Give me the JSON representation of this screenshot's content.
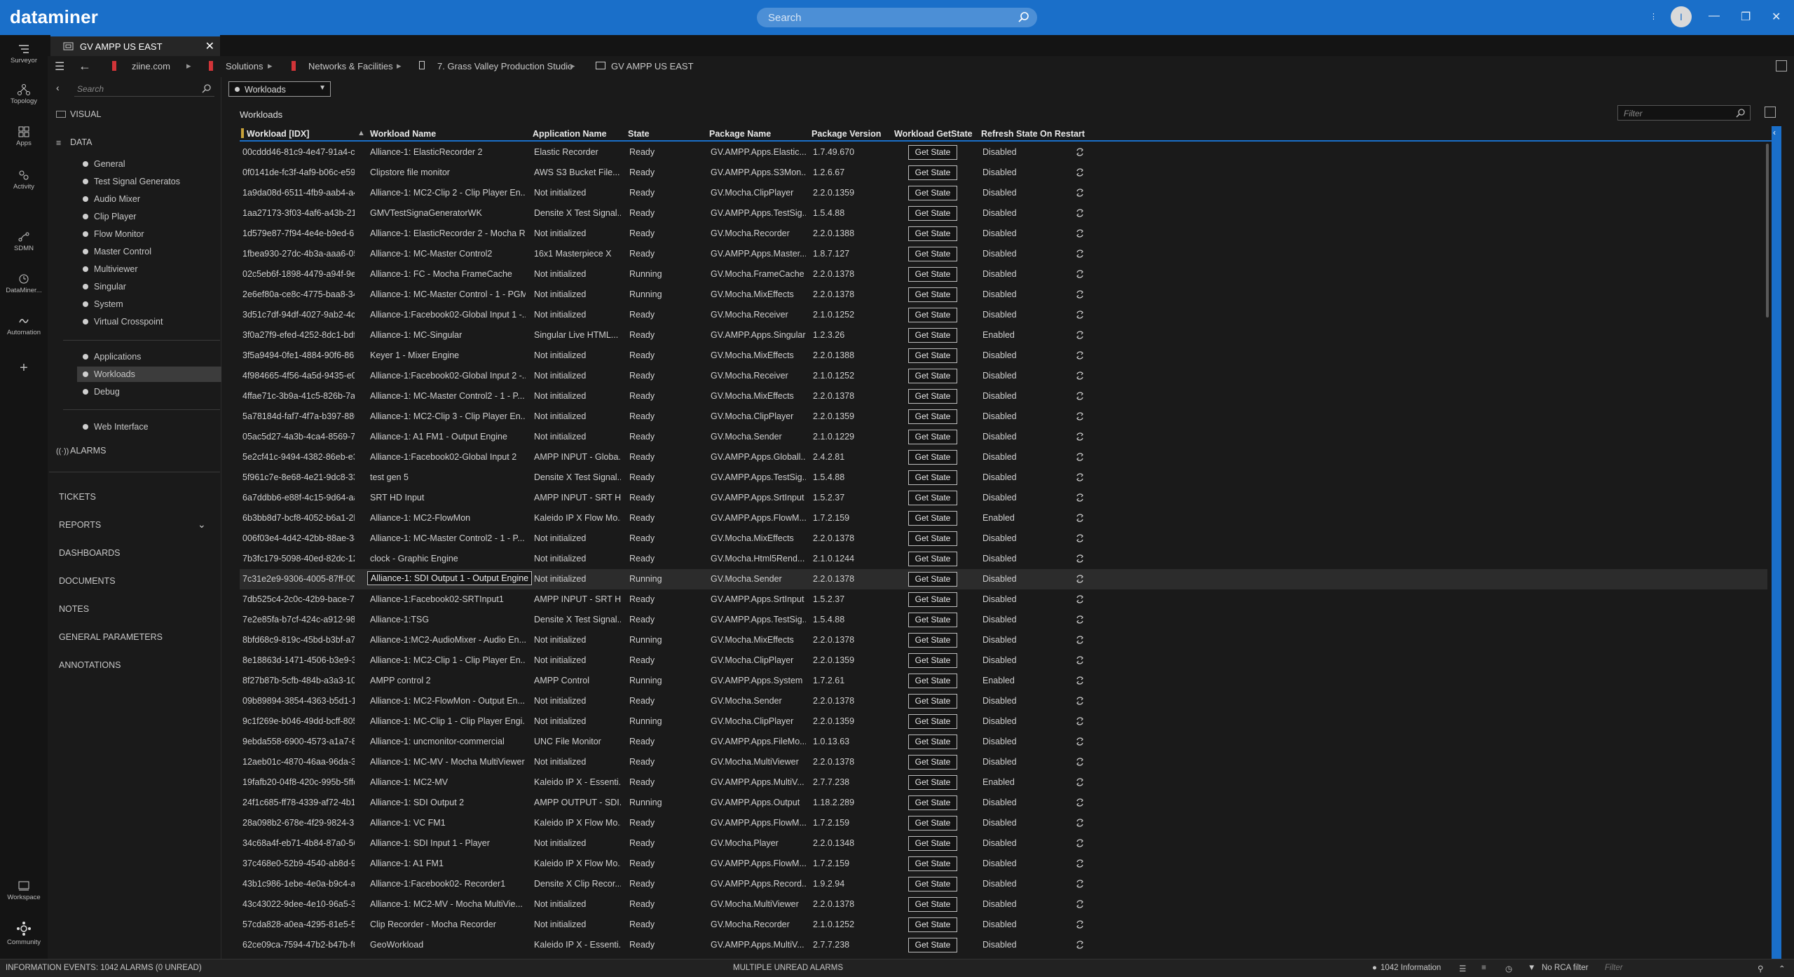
{
  "app": {
    "brand": "dataminer",
    "search_placeholder": "Search",
    "user_initial": "I"
  },
  "rail": [
    {
      "label": "Surveyor",
      "icon": "surveyor-icon"
    },
    {
      "label": "Topology",
      "icon": "topology-icon"
    },
    {
      "label": "Apps",
      "icon": "apps-icon"
    },
    {
      "label": "Activity",
      "icon": "activity-icon"
    },
    {
      "label": "SDMN",
      "icon": "sdmn-icon"
    },
    {
      "label": "DataMiner...",
      "icon": "dataminer-icon"
    },
    {
      "label": "Automation",
      "icon": "automation-icon"
    },
    {
      "label": "",
      "icon": "plus-icon"
    },
    {
      "label": "Workspace",
      "icon": "workspace-icon"
    },
    {
      "label": "Community",
      "icon": "community-icon"
    }
  ],
  "tab": {
    "label": "GV AMPP US EAST"
  },
  "breadcrumb": [
    "ziine.com",
    "Solutions",
    "Networks & Facilities",
    "7. Grass Valley Production Studio",
    "GV AMPP US EAST"
  ],
  "left_panel": {
    "search_placeholder": "Search",
    "visual": "VISUAL",
    "data": "DATA",
    "data_items": [
      "General",
      "Test Signal Generatos",
      "Audio Mixer",
      "Clip Player",
      "Flow Monitor",
      "Master Control",
      "Multiviewer",
      "Singular",
      "System",
      "Virtual Crosspoint"
    ],
    "items2": [
      "Applications",
      "Workloads",
      "Debug"
    ],
    "items3": [
      "Web Interface"
    ],
    "alarms": "ALARMS",
    "menu": [
      "TICKETS",
      "REPORTS",
      "DASHBOARDS",
      "DOCUMENTS",
      "NOTES",
      "GENERAL PARAMETERS",
      "ANNOTATIONS"
    ]
  },
  "main": {
    "dropdown_value": "Workloads",
    "table_title": "Workloads",
    "filter_placeholder": "Filter",
    "columns": [
      "Workload [IDX]",
      "Workload Name",
      "Application Name",
      "State",
      "Package Name",
      "Package Version",
      "Workload GetState",
      "Refresh State On Restart"
    ],
    "button_label": "Get State",
    "rows": [
      [
        "00cddd46-81c9-4e47-91a4-c2...",
        "Alliance-1: ElasticRecorder 2",
        "Elastic Recorder",
        "Ready",
        "GV.AMPP.Apps.Elastic...",
        "1.7.49.670",
        "Disabled"
      ],
      [
        "0f0141de-fc3f-4af9-b06c-e596...",
        "Clipstore file monitor",
        "AWS S3 Bucket File...",
        "Ready",
        "GV.AMPP.Apps.S3Mon...",
        "1.2.6.67",
        "Disabled"
      ],
      [
        "1a9da08d-6511-4fb9-aab4-a4...",
        "Alliance-1: MC2-Clip 2 - Clip Player En...",
        "Not initialized",
        "Ready",
        "GV.Mocha.ClipPlayer",
        "2.2.0.1359",
        "Disabled"
      ],
      [
        "1aa27173-3f03-4af6-a43b-215...",
        "GMVTestSignaGeneratorWK",
        "Densite X Test Signal...",
        "Ready",
        "GV.AMPP.Apps.TestSig...",
        "1.5.4.88",
        "Disabled"
      ],
      [
        "1d579e87-7f94-4e4e-b9ed-61...",
        "Alliance-1: ElasticRecorder 2 - Mocha R...",
        "Not initialized",
        "Ready",
        "GV.Mocha.Recorder",
        "2.2.0.1388",
        "Disabled"
      ],
      [
        "1fbea930-27dc-4b3a-aaa6-05...",
        "Alliance-1: MC-Master Control2",
        "16x1 Masterpiece X",
        "Ready",
        "GV.AMPP.Apps.Master...",
        "1.8.7.127",
        "Disabled"
      ],
      [
        "02c5eb6f-1898-4479-a94f-9e3...",
        "Alliance-1: FC - Mocha FrameCache",
        "Not initialized",
        "Running",
        "GV.Mocha.FrameCache",
        "2.2.0.1378",
        "Disabled"
      ],
      [
        "2e6ef80a-ce8c-4775-baa8-34e...",
        "Alliance-1: MC-Master Control - 1 - PGM",
        "Not initialized",
        "Running",
        "GV.Mocha.MixEffects",
        "2.2.0.1378",
        "Disabled"
      ],
      [
        "3d51c7df-94df-4027-9ab2-4cc...",
        "Alliance-1:Facebook02-Global Input 1 -...",
        "Not initialized",
        "Ready",
        "GV.Mocha.Receiver",
        "2.1.0.1252",
        "Disabled"
      ],
      [
        "3f0a27f9-efed-4252-8dc1-bdf...",
        "Alliance-1: MC-Singular",
        "Singular Live HTML...",
        "Ready",
        "GV.AMPP.Apps.Singular",
        "1.2.3.26",
        "Enabled"
      ],
      [
        "3f5a9494-0fe1-4884-90f6-86b...",
        "Keyer 1 - Mixer Engine",
        "Not initialized",
        "Ready",
        "GV.Mocha.MixEffects",
        "2.2.0.1388",
        "Disabled"
      ],
      [
        "4f984665-4f56-4a5d-9435-e00...",
        "Alliance-1:Facebook02-Global Input 2 -...",
        "Not initialized",
        "Ready",
        "GV.Mocha.Receiver",
        "2.1.0.1252",
        "Disabled"
      ],
      [
        "4ffae71c-3b9a-41c5-826b-7a1...",
        "Alliance-1: MC-Master Control2 - 1 - P...",
        "Not initialized",
        "Ready",
        "GV.Mocha.MixEffects",
        "2.2.0.1378",
        "Disabled"
      ],
      [
        "5a78184d-faf7-4f7a-b397-880...",
        "Alliance-1: MC2-Clip 3 - Clip Player En...",
        "Not initialized",
        "Ready",
        "GV.Mocha.ClipPlayer",
        "2.2.0.1359",
        "Disabled"
      ],
      [
        "05ac5d27-4a3b-4ca4-8569-71...",
        "Alliance-1: A1 FM1 - Output Engine",
        "Not initialized",
        "Ready",
        "GV.Mocha.Sender",
        "2.1.0.1229",
        "Disabled"
      ],
      [
        "5e2cf41c-9494-4382-86eb-e33...",
        "Alliance-1:Facebook02-Global Input 2",
        "AMPP INPUT - Globa...",
        "Ready",
        "GV.AMPP.Apps.Globall...",
        "2.4.2.81",
        "Disabled"
      ],
      [
        "5f961c7e-8e68-4e21-9dc8-335...",
        "test gen 5",
        "Densite X Test Signal...",
        "Ready",
        "GV.AMPP.Apps.TestSig...",
        "1.5.4.88",
        "Disabled"
      ],
      [
        "6a7ddbb6-e88f-4c15-9d64-aa...",
        "SRT HD Input",
        "AMPP INPUT - SRT HD",
        "Ready",
        "GV.AMPP.Apps.SrtInput",
        "1.5.2.37",
        "Disabled"
      ],
      [
        "6b3bb8d7-bcf8-4052-b6a1-2b...",
        "Alliance-1: MC2-FlowMon",
        "Kaleido IP X Flow Mo...",
        "Ready",
        "GV.AMPP.Apps.FlowM...",
        "1.7.2.159",
        "Enabled"
      ],
      [
        "006f03e4-4d42-42bb-88ae-34...",
        "Alliance-1: MC-Master Control2 - 1 - P...",
        "Not initialized",
        "Ready",
        "GV.Mocha.MixEffects",
        "2.2.0.1378",
        "Disabled"
      ],
      [
        "7b3fc179-5098-40ed-82dc-12...",
        "clock - Graphic Engine",
        "Not initialized",
        "Ready",
        "GV.Mocha.Html5Rend...",
        "2.1.0.1244",
        "Disabled"
      ],
      [
        "7c31e2e9-9306-4005-87ff-00a...",
        "Alliance-1: SDI Output 1 - Output Engine",
        "Not initialized",
        "Running",
        "GV.Mocha.Sender",
        "2.2.0.1378",
        "Disabled"
      ],
      [
        "7db525c4-2c0c-42b9-bace-78...",
        "Alliance-1:Facebook02-SRTInput1",
        "AMPP INPUT - SRT HD",
        "Ready",
        "GV.AMPP.Apps.SrtInput",
        "1.5.2.37",
        "Disabled"
      ],
      [
        "7e2e85fa-b7cf-424c-a912-983...",
        "Alliance-1:TSG",
        "Densite X Test Signal...",
        "Ready",
        "GV.AMPP.Apps.TestSig...",
        "1.5.4.88",
        "Disabled"
      ],
      [
        "8bfd68c9-819c-45bd-b3bf-a7...",
        "Alliance-1:MC2-AudioMixer - Audio En...",
        "Not initialized",
        "Running",
        "GV.Mocha.MixEffects",
        "2.2.0.1378",
        "Disabled"
      ],
      [
        "8e18863d-1471-4506-b3e9-39...",
        "Alliance-1: MC2-Clip 1 - Clip Player En...",
        "Not initialized",
        "Ready",
        "GV.Mocha.ClipPlayer",
        "2.2.0.1359",
        "Disabled"
      ],
      [
        "8f27b87b-5cfb-484b-a3a3-10c...",
        "AMPP control 2",
        "AMPP Control",
        "Running",
        "GV.AMPP.Apps.System",
        "1.7.2.61",
        "Enabled"
      ],
      [
        "09b89894-3854-4363-b5d1-1a...",
        "Alliance-1: MC2-FlowMon - Output En...",
        "Not initialized",
        "Ready",
        "GV.Mocha.Sender",
        "2.2.0.1378",
        "Disabled"
      ],
      [
        "9c1f269e-b046-49dd-bcff-805...",
        "Alliance-1: MC-Clip 1 - Clip Player Engi...",
        "Not initialized",
        "Running",
        "GV.Mocha.ClipPlayer",
        "2.2.0.1359",
        "Disabled"
      ],
      [
        "9ebda558-6900-4573-a1a7-8e...",
        "Alliance-1: uncmonitor-commercial",
        "UNC File Monitor",
        "Ready",
        "GV.AMPP.Apps.FileMo...",
        "1.0.13.63",
        "Disabled"
      ],
      [
        "12aeb01c-4870-46aa-96da-3b...",
        "Alliance-1: MC-MV - Mocha MultiViewer",
        "Not initialized",
        "Ready",
        "GV.Mocha.MultiViewer",
        "2.2.0.1378",
        "Disabled"
      ],
      [
        "19fafb20-04f8-420c-995b-5ffd...",
        "Alliance-1: MC2-MV",
        "Kaleido IP X - Essenti...",
        "Ready",
        "GV.AMPP.Apps.MultiV...",
        "2.7.7.238",
        "Enabled"
      ],
      [
        "24f1c685-ff78-4339-af72-4b14...",
        "Alliance-1: SDI Output 2",
        "AMPP OUTPUT - SDI...",
        "Running",
        "GV.AMPP.Apps.Output",
        "1.18.2.289",
        "Disabled"
      ],
      [
        "28a098b2-678e-4f29-9824-310...",
        "Alliance-1: VC FM1",
        "Kaleido IP X Flow Mo...",
        "Ready",
        "GV.AMPP.Apps.FlowM...",
        "1.7.2.159",
        "Disabled"
      ],
      [
        "34c68a4f-eb71-4b84-87a0-507...",
        "Alliance-1: SDI Input 1 - Player",
        "Not initialized",
        "Ready",
        "GV.Mocha.Player",
        "2.2.0.1348",
        "Disabled"
      ],
      [
        "37c468e0-52b9-4540-ab8d-9e...",
        "Alliance-1: A1 FM1",
        "Kaleido IP X Flow Mo...",
        "Ready",
        "GV.AMPP.Apps.FlowM...",
        "1.7.2.159",
        "Disabled"
      ],
      [
        "43b1c986-1ebe-4e0a-b9c4-a7...",
        "Alliance-1:Facebook02- Recorder1",
        "Densite X Clip Recor...",
        "Ready",
        "GV.AMPP.Apps.Record...",
        "1.9.2.94",
        "Disabled"
      ],
      [
        "43c43022-9dee-4e10-96a5-31...",
        "Alliance-1: MC2-MV - Mocha MultiVie...",
        "Not initialized",
        "Ready",
        "GV.Mocha.MultiViewer",
        "2.2.0.1378",
        "Disabled"
      ],
      [
        "57cda828-a0ea-4295-81e5-59...",
        "Clip Recorder - Mocha Recorder",
        "Not initialized",
        "Ready",
        "GV.Mocha.Recorder",
        "2.1.0.1252",
        "Disabled"
      ],
      [
        "62ce09ca-7594-47b2-b47b-f6...",
        "GeoWorkload",
        "Kaleido IP X - Essenti...",
        "Ready",
        "GV.AMPP.Apps.MultiV...",
        "2.7.7.238",
        "Disabled"
      ]
    ]
  },
  "status": {
    "left": "INFORMATION EVENTS: 1042 ALARMS (0 UNREAD)",
    "center": "MULTIPLE UNREAD ALARMS",
    "info": "1042 Information",
    "rca": "No RCA filter",
    "filter_placeholder": "Filter"
  },
  "colors": {
    "accent": "#1a6fc9",
    "background": "#1a1a1a"
  }
}
